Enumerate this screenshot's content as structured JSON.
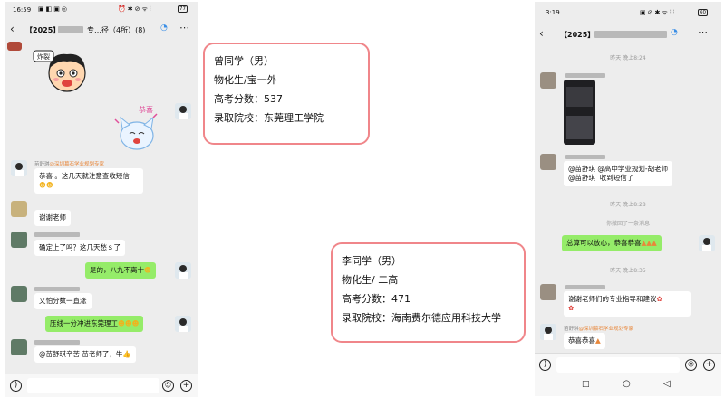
{
  "left_phone": {
    "status": {
      "time": "16:59",
      "battery": "77"
    },
    "title": "【2025】",
    "title_suffix": "专…径（4所）(8)",
    "sticker_caption": "炸裂",
    "congrats_sticker": "恭喜",
    "sender_name": "苗舒琪",
    "sender_role": "@深圳慕石学业规划专家",
    "messages": [
      {
        "text": "恭喜 。这几天就注意查收短信"
      },
      {
        "text": "谢谢老师"
      },
      {
        "text": "确定上了吗？这几天愁ｓ了"
      },
      {
        "text": "是的，八九不离十"
      },
      {
        "text": "又怕分数一直涨"
      },
      {
        "text": "压线一分冲进东莞理工"
      },
      {
        "text": "@苗舒琪辛苦  苗老师了，牛"
      }
    ]
  },
  "cards": [
    {
      "name": "曾同学（男）",
      "subjects": "物化生/宝一外",
      "score": "高考分数：537",
      "school": "录取院校：东莞理工学院"
    },
    {
      "name": "李同学（男）",
      "subjects": "物化生/ 二高",
      "score": "高考分数：471",
      "school": "录取院校：海南费尔德应用科技大学"
    }
  ],
  "right_phone": {
    "status": {
      "time": "3:19",
      "battery": "60"
    },
    "title": "【2025】",
    "times": [
      "昨天 晚上8:24",
      "昨天 晚上8:28",
      "昨天 晚上8:35"
    ],
    "recall_notice": "你撤回了一条消息",
    "messages": [
      {
        "text": "@苗舒琪 @高中学业规划-胡老师\n@苗舒琪  收到短信了"
      },
      {
        "text": "总算可以放心，恭喜恭喜"
      },
      {
        "text": "谢谢老师们的专业指导和建议"
      },
      {
        "text": "恭喜恭喜"
      }
    ],
    "sender_name": "苗舒琪",
    "sender_role": "@深圳慕石学业规划专家"
  },
  "colors": {
    "chat_bg": "#ededed",
    "green_bubble": "#95ec69",
    "card_border": "#f0868a"
  }
}
